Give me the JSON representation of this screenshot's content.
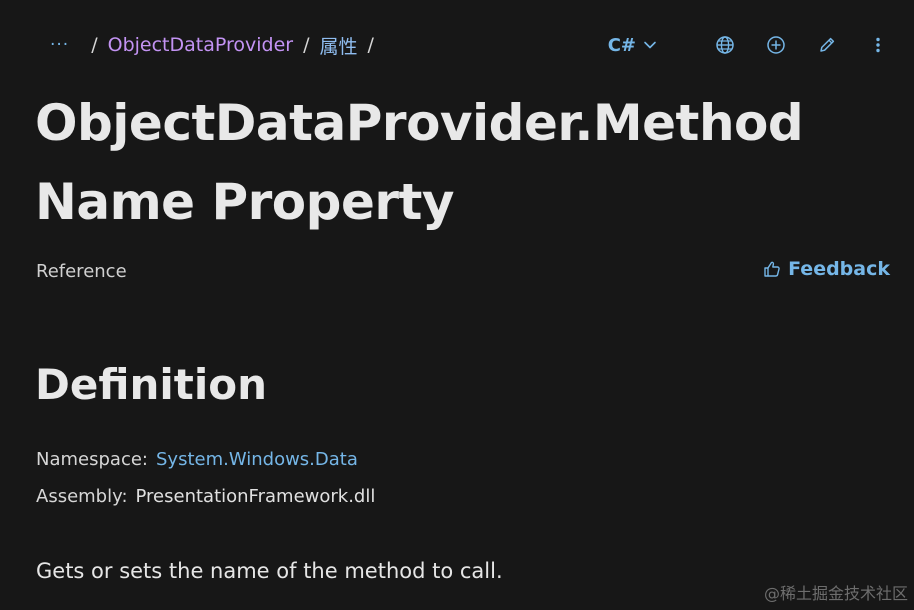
{
  "breadcrumb": {
    "more_label": "···",
    "separator": "/",
    "items": [
      "ObjectDataProvider",
      "属性"
    ]
  },
  "toolbar": {
    "language_label": "C#",
    "icons": [
      "globe-icon",
      "add-circle-icon",
      "edit-icon",
      "more-vertical-icon"
    ]
  },
  "page": {
    "title": "ObjectDataProvider.MethodName Property",
    "title_line1": "ObjectDataProvider.Method",
    "title_line2": "Name Property",
    "reference_label": "Reference",
    "feedback_label": "Feedback"
  },
  "definition": {
    "heading": "Definition",
    "namespace_label": "Namespace:",
    "namespace_value": "System.Windows.Data",
    "assembly_label": "Assembly:",
    "assembly_value": "PresentationFramework.dll"
  },
  "summary": "Gets or sets the name of the method to call.",
  "watermark": "@稀土掘金技术社区",
  "colors": {
    "background": "#171717",
    "link_blue": "#75b6e7",
    "link_purple": "#c393f3",
    "text": "#e6e6e6"
  }
}
